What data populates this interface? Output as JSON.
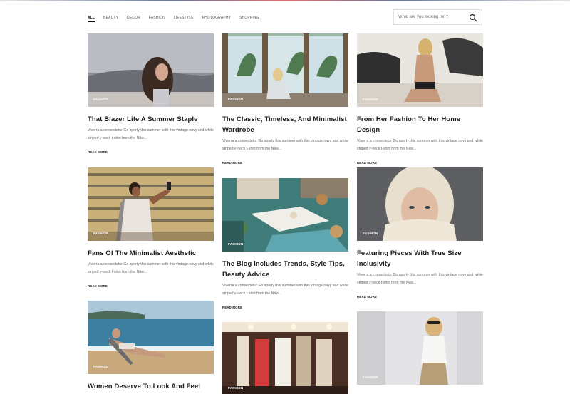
{
  "filters": [
    "ALL",
    "BEAUTY",
    "DECOR",
    "FASHION",
    "LIFESTYLE",
    "PHOTOGRAPHY",
    "SHOPPING"
  ],
  "search": {
    "placeholder": "What are you looking for ?"
  },
  "posts": [
    {
      "category": "FASHION",
      "title": "That Blazer Life A Summer Staple",
      "excerpt": "Viverra a consectetur Go sporty this summer with this vintage navy and white striped v-neck t-shirt from the Nike...",
      "read_more": "READ MORE"
    },
    {
      "category": "FASHION",
      "title": "The Classic, Timeless, And Minimalist Wardrobe",
      "excerpt": "Viverra a consectetur Go sporty this summer with this vintage navy and white striped v-neck t-shirt from the Nike...",
      "read_more": "READ MORE"
    },
    {
      "category": "FASHION",
      "title": "From Her Fashion To Her Home Design",
      "excerpt": "Viverra a consectetur Go sporty this summer with this vintage navy and white striped v-neck t-shirt from the Nike...",
      "read_more": "READ MORE"
    },
    {
      "category": "FASHION",
      "title": "Fans Of The Minimalist Aesthetic",
      "excerpt": "Viverra a consectetur Go sporty this summer with this vintage navy and white striped v-neck t-shirt from the Nike...",
      "read_more": "READ MORE"
    },
    {
      "category": "FASHION",
      "title": "The Blog Includes Trends, Style Tips, Beauty Advice",
      "excerpt": "Viverra a consectetur Go sporty this summer with this vintage navy and white striped v-neck t-shirt from the Nike...",
      "read_more": "READ MORE"
    },
    {
      "category": "FASHION",
      "title": "Featuring Pieces With True Size Inclusivity",
      "excerpt": "Viverra a consectetur Go sporty this summer with this vintage navy and white striped v-neck t-shirt from the Nike...",
      "read_more": "READ MORE"
    },
    {
      "category": "FASHION",
      "title": "Women Deserve To Look And Feel",
      "excerpt": "",
      "read_more": ""
    },
    {
      "category": "FASHION",
      "title": "",
      "excerpt": "",
      "read_more": ""
    },
    {
      "category": "FASHION",
      "title": "",
      "excerpt": "",
      "read_more": ""
    }
  ]
}
